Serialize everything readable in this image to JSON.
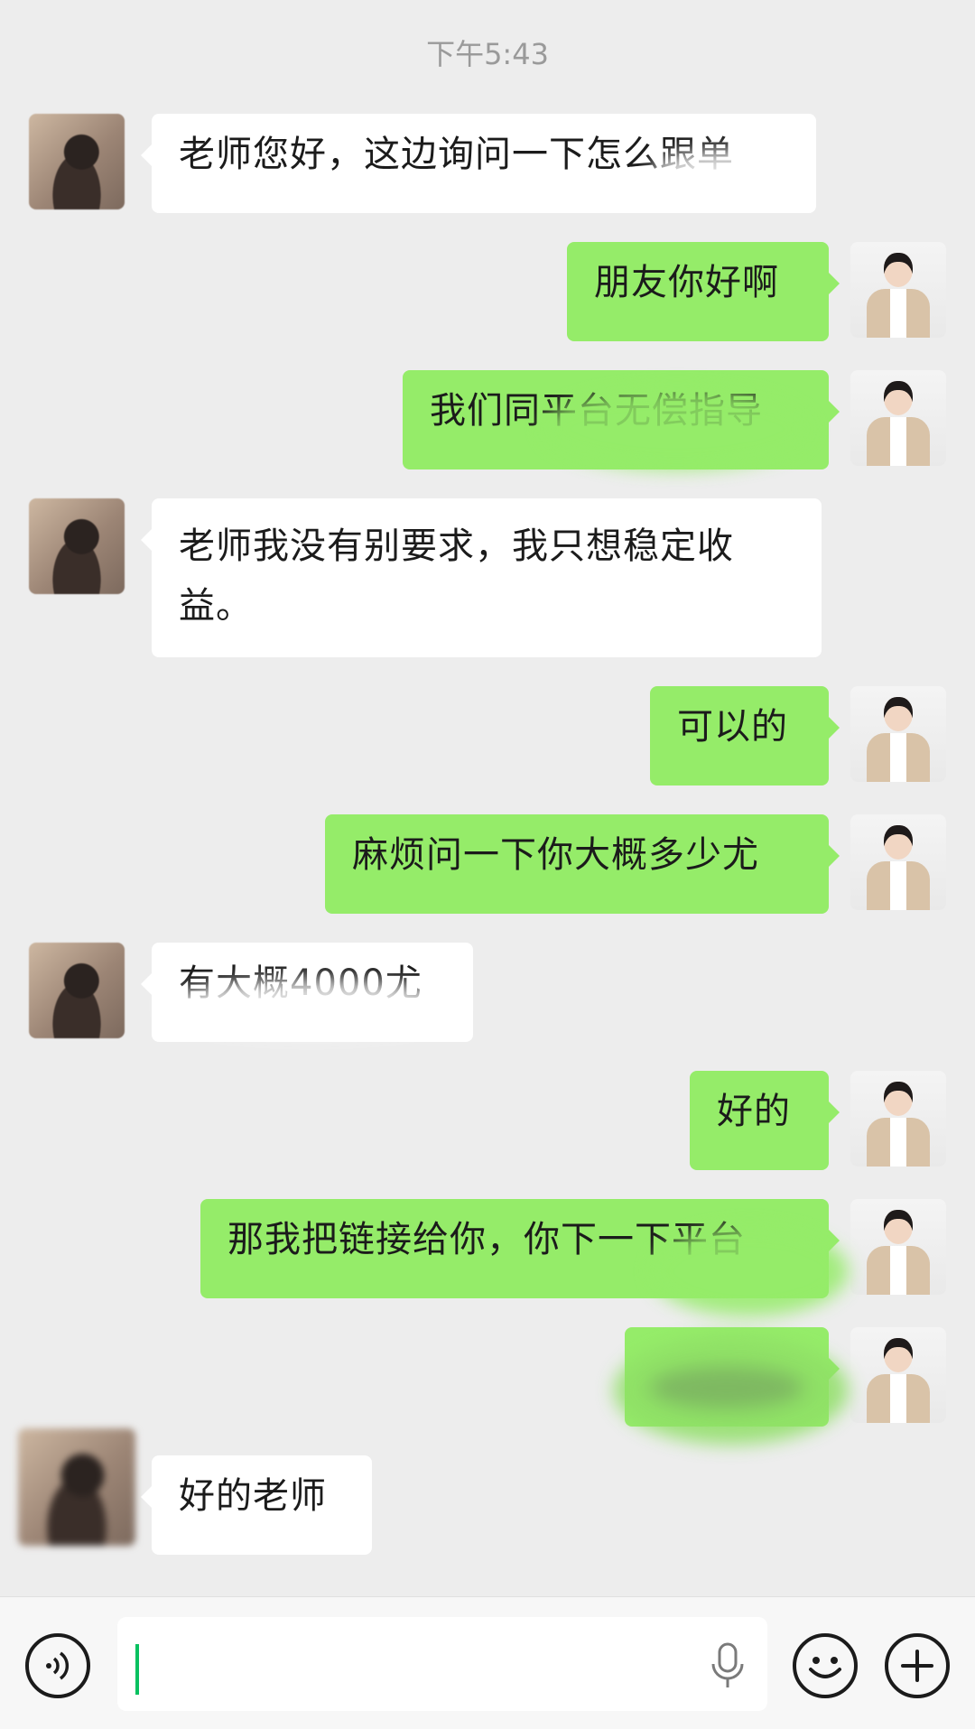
{
  "timestamp": "下午5:43",
  "messages": [
    {
      "side": "in",
      "text": "老师您好，这边询问一下怎么跟单"
    },
    {
      "side": "out",
      "text": "朋友你好啊"
    },
    {
      "side": "out",
      "text": "我们同平台无偿指导"
    },
    {
      "side": "in",
      "text": "老师我没有别要求，我只想稳定收益。"
    },
    {
      "side": "out",
      "text": "可以的"
    },
    {
      "side": "out",
      "text": "麻烦问一下你大概多少尤"
    },
    {
      "side": "in",
      "text": "有大概4000尤"
    },
    {
      "side": "out",
      "text": "好的"
    },
    {
      "side": "out",
      "text": "那我把链接给你，你下一下平台"
    },
    {
      "side": "out",
      "text": ""
    },
    {
      "side": "in",
      "text": "好的老师"
    }
  ],
  "input": {
    "value": "",
    "placeholder": ""
  },
  "colors": {
    "background": "#ededed",
    "outgoing": "#95ec69",
    "incoming": "#ffffff",
    "accent": "#07c160"
  },
  "icons": {
    "voice": "voice-icon",
    "mic": "microphone-icon",
    "emoji": "emoji-icon",
    "plus": "plus-icon"
  }
}
